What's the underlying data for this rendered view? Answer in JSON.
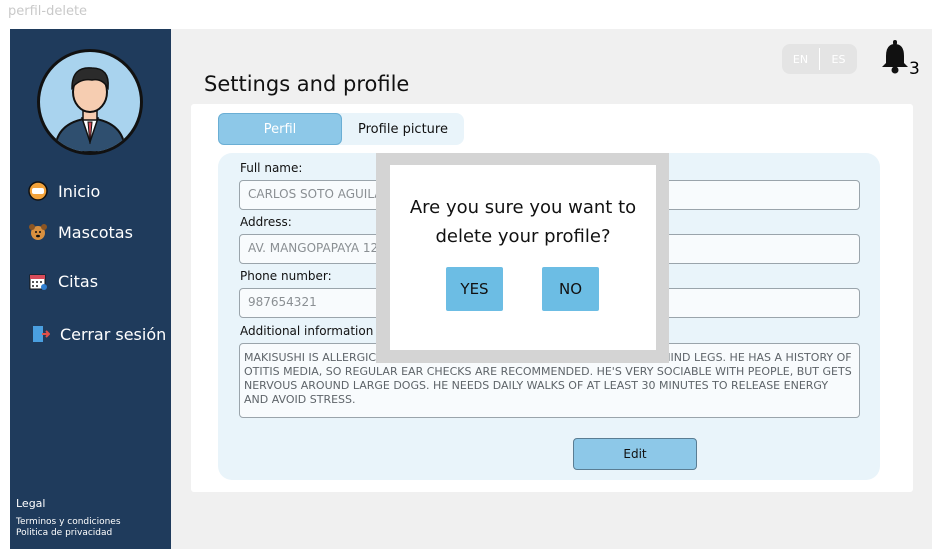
{
  "frame_label": "perfil-delete",
  "sidebar": {
    "items": [
      {
        "label": "Inicio",
        "icon": "start-icon"
      },
      {
        "label": "Mascotas",
        "icon": "dog-icon"
      },
      {
        "label": "Citas",
        "icon": "calendar-icon"
      },
      {
        "label": "Cerrar sesión",
        "icon": "logout-icon"
      }
    ],
    "legal_title": "Legal",
    "legal_links": [
      "Terminos y condiciones",
      "Politica de privacidad"
    ]
  },
  "header": {
    "title": "Settings and profile",
    "lang_en": "EN",
    "lang_es": "ES",
    "notification_count": "3"
  },
  "tabs": {
    "perfil": "Perfil",
    "picture": "Profile picture"
  },
  "form": {
    "full_name_label": "Full name:",
    "full_name_value": "CARLOS SOTO AGUILAR",
    "address_label": "Address:",
    "address_value": "AV. MANGOPAPAYA 123",
    "phone_label": "Phone number:",
    "phone_value": "987654321",
    "additional_label": "Additional information",
    "additional_value": "MAKISUSHI IS ALLERGIC TO CHICKEN AND BEEF, HE ALSO HAS PAIN ON HIS HIND LEGS. HE HAS A HISTORY OF OTITIS MEDIA, SO REGULAR EAR CHECKS ARE RECOMMENDED. HE'S VERY SOCIABLE WITH PEOPLE, BUT GETS NERVOUS AROUND LARGE DOGS. HE NEEDS DAILY WALKS OF AT LEAST 30 MINUTES TO RELEASE ENERGY AND AVOID STRESS.",
    "edit_label": "Edit"
  },
  "modal": {
    "message": "Are you sure you want to delete your profile?",
    "yes_label": "YES",
    "no_label": "NO"
  },
  "colors": {
    "sidebar": "#1f3b5c",
    "accent": "#8dc8e8",
    "modal_button": "#6cbde4",
    "card_bg": "#e9f4fa"
  }
}
